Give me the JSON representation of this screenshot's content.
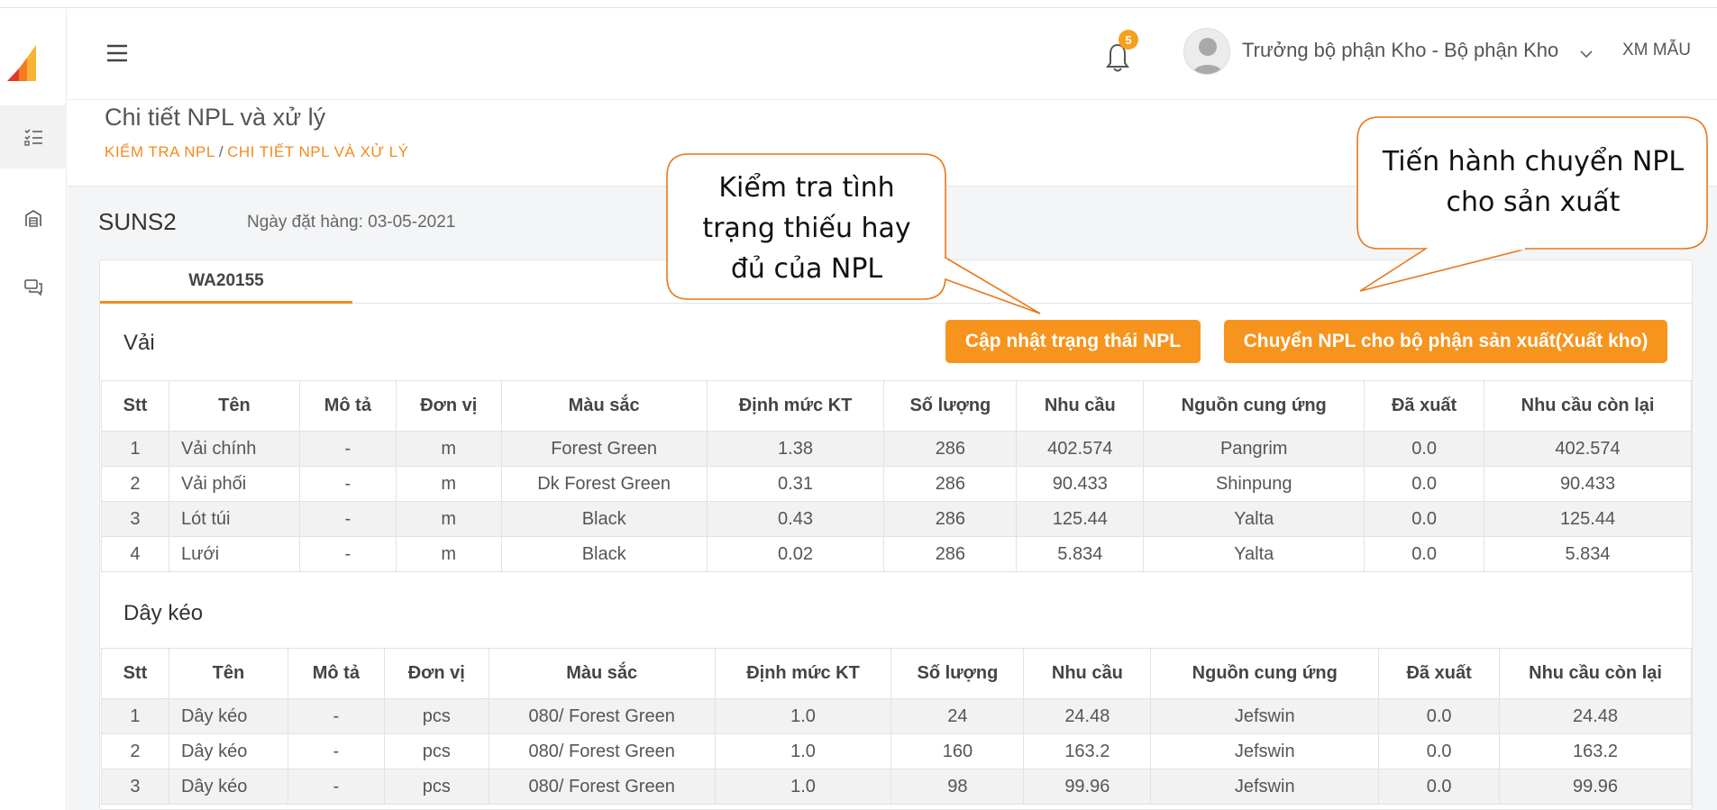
{
  "header": {
    "notification_count": "5",
    "user_name": "Trưởng bộ phận Kho - Bộ phận Kho",
    "company": "XM MẪU"
  },
  "sidebar": {
    "items": [
      {
        "icon": "checklist-icon",
        "active": true
      },
      {
        "icon": "warehouse-icon",
        "active": false
      },
      {
        "icon": "chat-icon",
        "active": false
      }
    ]
  },
  "page": {
    "title": "Chi tiết NPL và xử lý",
    "breadcrumb": [
      "KIỂM TRA NPL",
      "CHI TIẾT NPL VÀ XỬ LÝ"
    ],
    "breadcrumb_sep": "/"
  },
  "order": {
    "code": "SUNS2",
    "date_label": "Ngày đặt hàng:",
    "date": "03-05-2021"
  },
  "tabs": [
    {
      "label": "WA20155",
      "active": true
    }
  ],
  "buttons": {
    "update_status": "Cập nhật trạng thái NPL",
    "transfer": "Chuyển NPL cho bộ phận sản xuất(Xuất kho)"
  },
  "callouts": {
    "check": [
      "Kiểm tra tình",
      "trạng thiếu hay",
      "đủ của NPL"
    ],
    "transfer": [
      "Tiến hành chuyển NPL",
      "cho sản xuất"
    ]
  },
  "columns": [
    "Stt",
    "Tên",
    "Mô tả",
    "Đơn vị",
    "Màu sắc",
    "Định mức KT",
    "Số lượng",
    "Nhu cầu",
    "Nguồn cung ứng",
    "Đã xuất",
    "Nhu cầu còn lại"
  ],
  "sections": [
    {
      "title": "Vải",
      "rows": [
        [
          "1",
          "Vải chính",
          "-",
          "m",
          "Forest Green",
          "1.38",
          "286",
          "402.574",
          "Pangrim",
          "0.0",
          "402.574"
        ],
        [
          "2",
          "Vải phối",
          "-",
          "m",
          "Dk Forest Green",
          "0.31",
          "286",
          "90.433",
          "Shinpung",
          "0.0",
          "90.433"
        ],
        [
          "3",
          "Lót túi",
          "-",
          "m",
          "Black",
          "0.43",
          "286",
          "125.44",
          "Yalta",
          "0.0",
          "125.44"
        ],
        [
          "4",
          "Lưới",
          "-",
          "m",
          "Black",
          "0.02",
          "286",
          "5.834",
          "Yalta",
          "0.0",
          "5.834"
        ]
      ]
    },
    {
      "title": "Dây kéo",
      "rows": [
        [
          "1",
          "Dây kéo",
          "-",
          "pcs",
          "080/ Forest Green",
          "1.0",
          "24",
          "24.48",
          "Jefswin",
          "0.0",
          "24.48"
        ],
        [
          "2",
          "Dây kéo",
          "-",
          "pcs",
          "080/ Forest Green",
          "1.0",
          "160",
          "163.2",
          "Jefswin",
          "0.0",
          "163.2"
        ],
        [
          "3",
          "Dây kéo",
          "-",
          "pcs",
          "080/ Forest Green",
          "1.0",
          "98",
          "99.96",
          "Jefswin",
          "0.0",
          "99.96"
        ]
      ]
    }
  ],
  "colors": {
    "accent": "#f7941d",
    "breadcrumb": "#f28b1e",
    "callout_border": "#e8771a"
  }
}
